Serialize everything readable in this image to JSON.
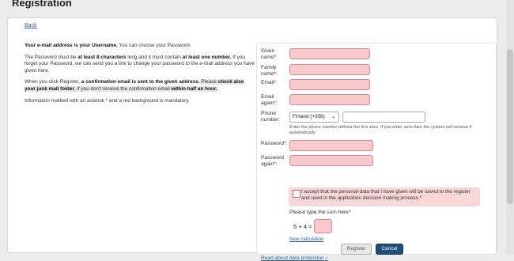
{
  "page": {
    "title": "Registration"
  },
  "nav": {
    "back": "Back"
  },
  "info": {
    "p1_a": "Your e-mail address is your Username.",
    "p1_b": " You can choose your Password.",
    "p2_a": "The Password must be ",
    "p2_b": "at least 8 characters",
    "p2_c": " long and it must contain ",
    "p2_d": "at least one number.",
    "p2_e": " If you forget your Password, we can send you a link to change your password to the e-mail address you have given here.",
    "p3_a": "When you click Register, ",
    "p3_b": "a confirmation email is sent to the given address.",
    "p3_c": " Please ",
    "p3_d": "check also your junk mail folder",
    "p3_e": ", if you don't receive the confirmation email ",
    "p3_f": "within half an hour.",
    "p4": "Information marked with an asterisk * and a red background is mandatory."
  },
  "form": {
    "given_name_l1": "Given",
    "given_name_l2": "name*:",
    "family_name_l1": "Family",
    "family_name_l2": "name*:",
    "email_label": "Email*:",
    "email_again_l1": "Email",
    "email_again_l2": "again*:",
    "phone_l1": "Phone",
    "phone_l2": "number:",
    "country_selected": "Finland (+358)",
    "phone_hint": "Enter the phone number without the first zero. If you enter zero then the system will remove it automatically.",
    "password_label": "Password*:",
    "password_again_l1": "Password",
    "password_again_l2": "again*:",
    "consent_text": "I accept that the personal data that I have given will be saved to the register and used in the application decision making process.*",
    "sum_label": "Please type the sum here*",
    "sum_expr": "5 + 4 =",
    "new_calc": "New calculation",
    "data_protection": "Read about data protection",
    "register": "Register",
    "cancel": "Cancel"
  },
  "colors": {
    "required_bg": "#f7c9cc",
    "link": "#2a6496",
    "cancel_bg": "#1f4e79"
  }
}
